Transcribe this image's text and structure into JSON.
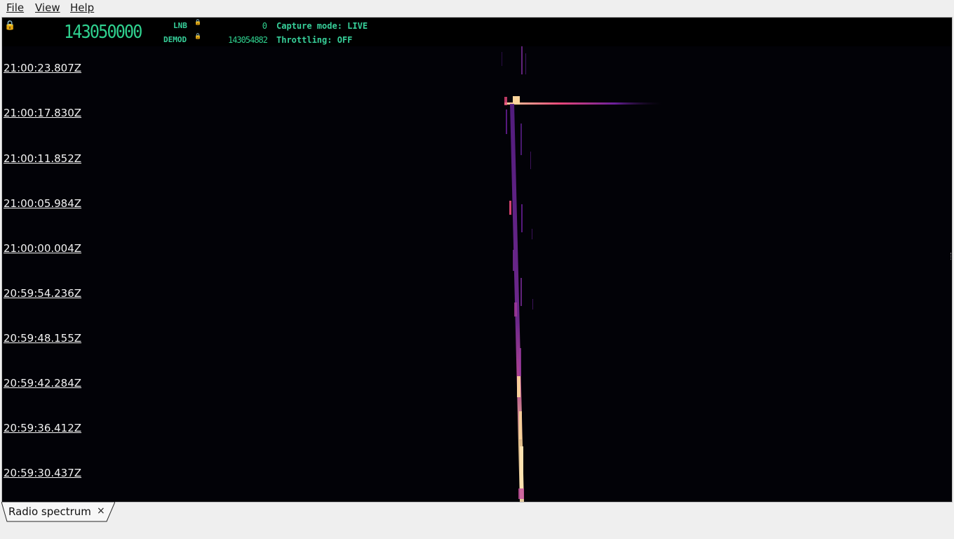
{
  "menu": {
    "items": [
      {
        "label": "File"
      },
      {
        "label": "View"
      },
      {
        "label": "Help"
      }
    ]
  },
  "header": {
    "main_frequency": "143050000",
    "lnb_label": "LNB",
    "lnb_value": "0",
    "demod_label": "DEMOD",
    "demod_value": "143054882",
    "capture_mode": "Capture mode: LIVE",
    "throttling": "Throttling: OFF"
  },
  "waterfall": {
    "timestamps": [
      "21:00:23.807Z",
      "21:00:17.830Z",
      "21:00:11.852Z",
      "21:00:05.984Z",
      "21:00:00.004Z",
      "20:59:54.236Z",
      "20:59:48.155Z",
      "20:59:42.284Z",
      "20:59:36.412Z",
      "20:59:30.437Z"
    ]
  },
  "tabs": [
    {
      "label": "Radio spectrum",
      "close": "×"
    }
  ],
  "colors": {
    "accent": "#2fd18f",
    "waterfall_bg": "#020207",
    "signal_hot": "#fbd49b",
    "signal_warm": "#e9487a",
    "signal_cool": "#6b1f9c"
  }
}
